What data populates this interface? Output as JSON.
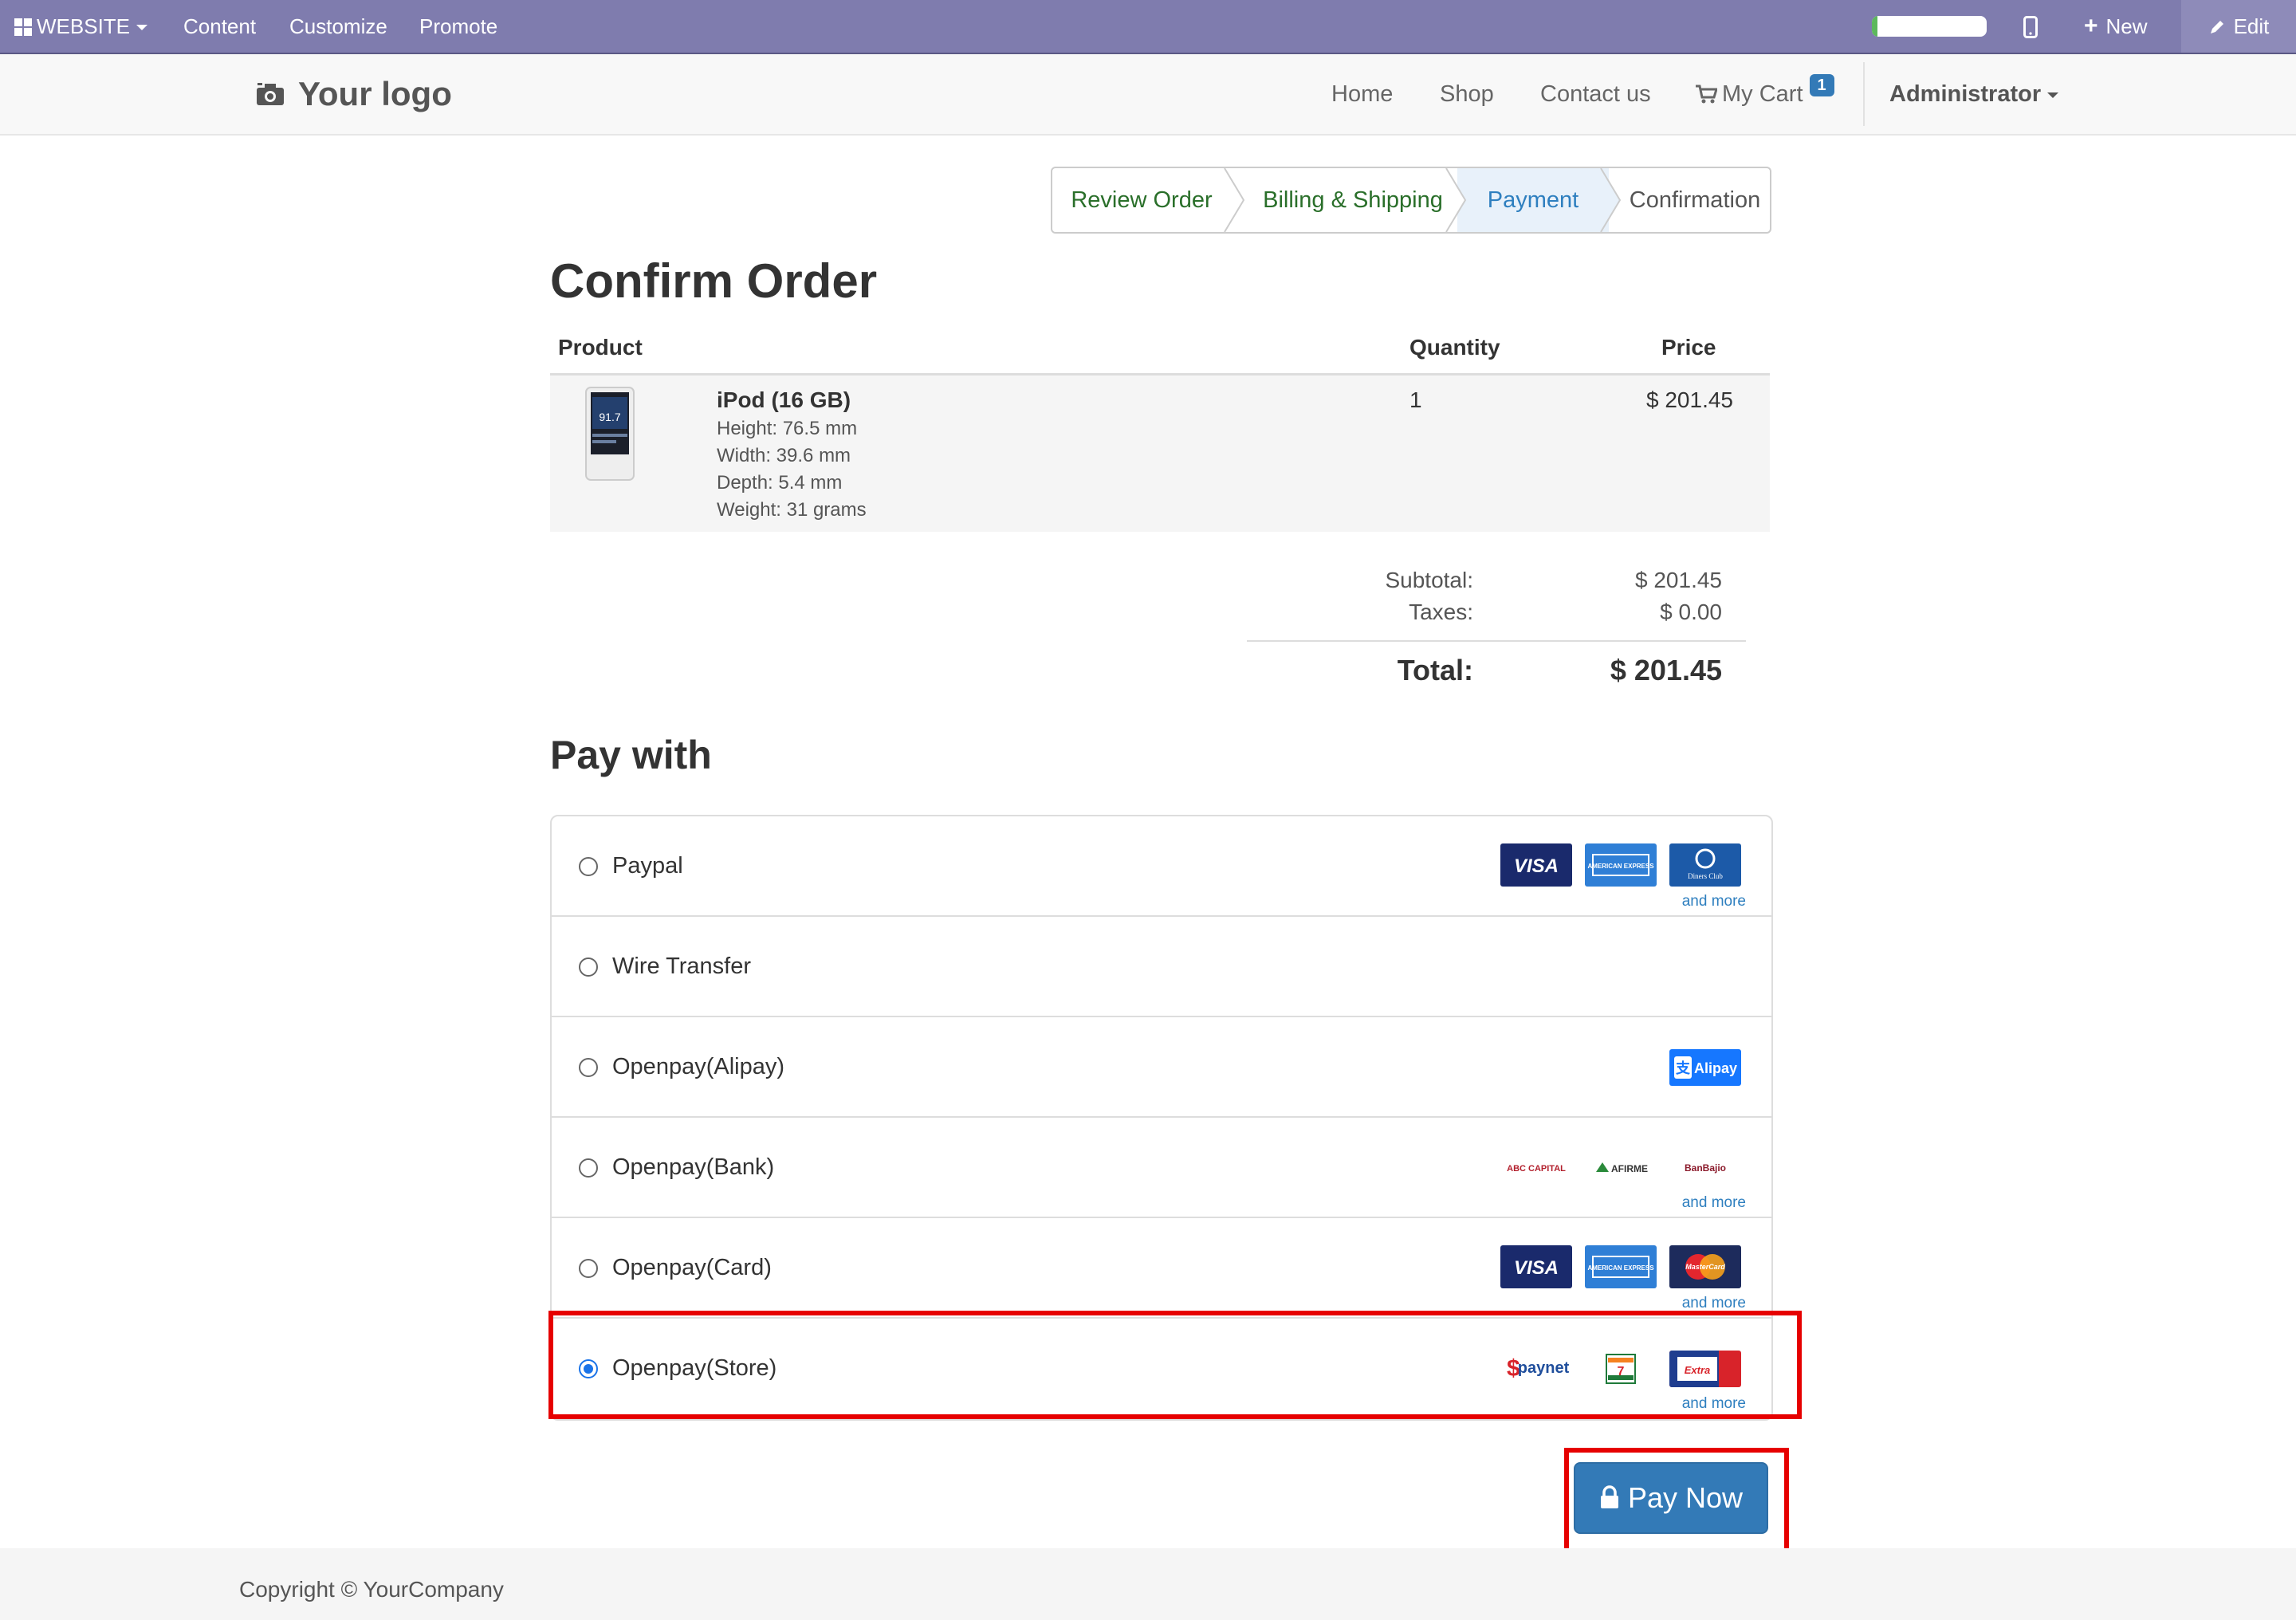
{
  "topbar": {
    "website_label": "WEBSITE",
    "content_label": "Content",
    "customize_label": "Customize",
    "promote_label": "Promote",
    "progress_fraction": 0.05,
    "new_label": "New",
    "edit_label": "Edit"
  },
  "navbar": {
    "logo_text": "Your logo",
    "home": "Home",
    "shop": "Shop",
    "contact": "Contact us",
    "cart_label": "My Cart",
    "cart_count": "1",
    "user": "Administrator"
  },
  "wizard": {
    "steps": [
      {
        "label": "Review Order",
        "state": "done"
      },
      {
        "label": "Billing & Shipping",
        "state": "done"
      },
      {
        "label": "Payment",
        "state": "active"
      },
      {
        "label": "Confirmation",
        "state": "todo"
      }
    ]
  },
  "order": {
    "title": "Confirm Order",
    "col_product": "Product",
    "col_quantity": "Quantity",
    "col_price": "Price",
    "product": {
      "name": "iPod (16 GB)",
      "attributes": [
        "Height: 76.5 mm",
        "Width: 39.6 mm",
        "Depth: 5.4 mm",
        "Weight: 31 grams"
      ],
      "quantity": "1",
      "price": "$ 201.45",
      "screen_text": "91.7"
    },
    "subtotal_label": "Subtotal:",
    "subtotal": "$ 201.45",
    "taxes_label": "Taxes:",
    "taxes": "$ 0.00",
    "total_label": "Total:",
    "total": "$ 201.45"
  },
  "payment": {
    "title": "Pay with",
    "and_more": "and more",
    "methods": [
      {
        "label": "Paypal",
        "icons": [
          "VISA",
          "AMERICAN EXPRESS",
          "Diners Club"
        ],
        "and_more": true,
        "selected": false
      },
      {
        "label": "Wire Transfer",
        "icons": [],
        "and_more": false,
        "selected": false
      },
      {
        "label": "Openpay(Alipay)",
        "icons": [
          "Alipay"
        ],
        "and_more": false,
        "selected": false
      },
      {
        "label": "Openpay(Bank)",
        "icons": [
          "ABC CAPITAL",
          "AFIRME",
          "BanBajio"
        ],
        "and_more": true,
        "selected": false
      },
      {
        "label": "Openpay(Card)",
        "icons": [
          "VISA",
          "AMERICAN EXPRESS",
          "MasterCard"
        ],
        "and_more": true,
        "selected": false
      },
      {
        "label": "Openpay(Store)",
        "icons": [
          "paynet",
          "7-Eleven",
          "Extra"
        ],
        "and_more": true,
        "selected": true
      }
    ],
    "pay_now": "Pay Now"
  },
  "footer": {
    "copyright": "Copyright © YourCompany"
  },
  "colors": {
    "topbar": "#7f7cae",
    "primary": "#337ab7",
    "highlight": "#e60000",
    "wizard_done": "#2a6f2a",
    "wizard_active": "#2e7fbf"
  }
}
